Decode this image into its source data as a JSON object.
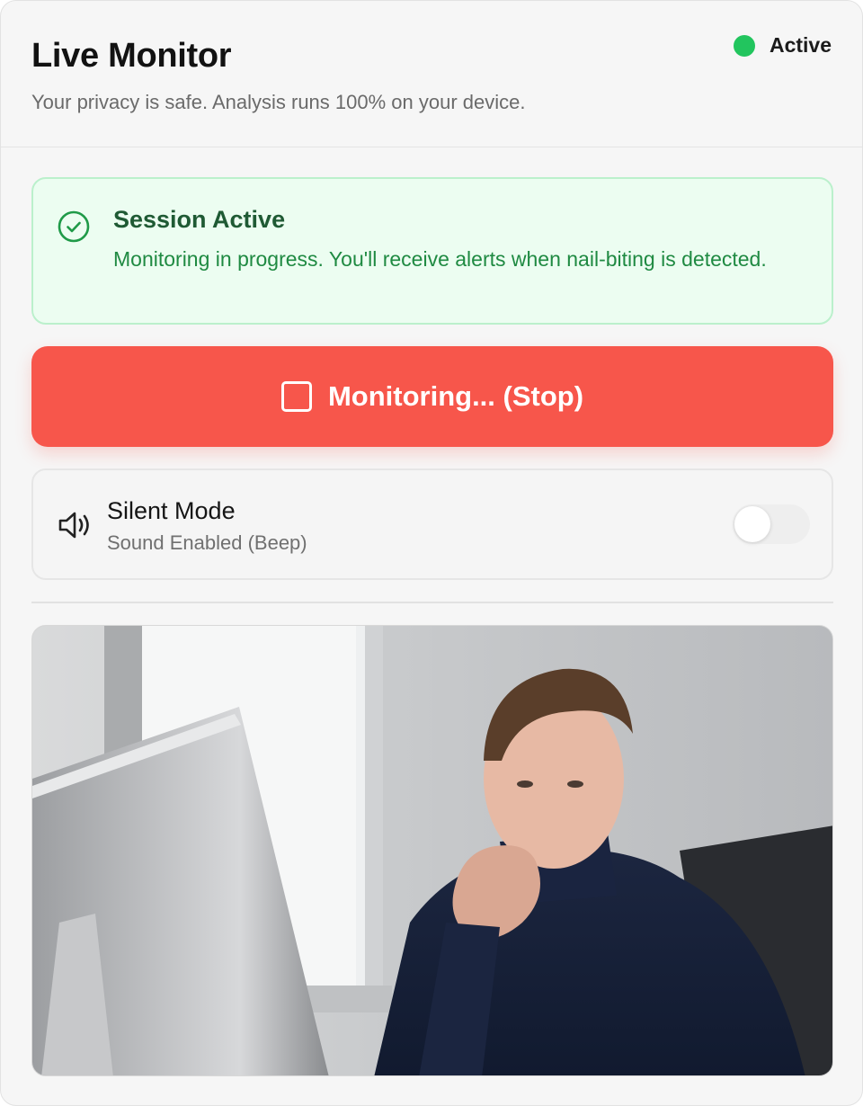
{
  "header": {
    "title": "Live Monitor",
    "subtitle": "Your privacy is safe. Analysis runs 100% on your device.",
    "status_label": "Active",
    "status_color": "#22c55e"
  },
  "session": {
    "title": "Session Active",
    "message": "Monitoring in progress. You'll receive alerts when nail-biting is detected.",
    "icon": "check-circle-icon"
  },
  "stop_button": {
    "label": "Monitoring... (Stop)",
    "icon": "stop-square-icon",
    "color": "#f7564b"
  },
  "silent_mode": {
    "title": "Silent Mode",
    "subtitle": "Sound Enabled (Beep)",
    "icon": "speaker-icon",
    "enabled": false
  },
  "camera": {
    "description": "live-camera-feed"
  }
}
